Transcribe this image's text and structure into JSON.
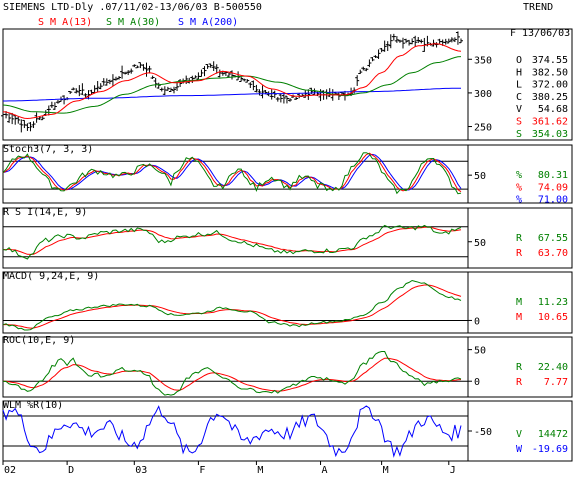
{
  "header": {
    "title": "SIEMENS LTD-Dly .07/11/02-13/06/03  B-500550",
    "trend_label": "TREND",
    "legend": [
      {
        "label": "S M A(13)",
        "color": "#ff0000"
      },
      {
        "label": "S M A(30)",
        "color": "#008000"
      },
      {
        "label": "S M A(200)",
        "color": "#0000ff"
      }
    ]
  },
  "x_axis_labels": [
    "02",
    "D",
    "03",
    "F",
    "M",
    "A",
    "M",
    "J"
  ],
  "colors": {
    "red": "#ff0000",
    "green": "#008000",
    "blue": "#0000ff",
    "black": "#000000",
    "frame": "#000000"
  },
  "chart_data": [
    {
      "type": "line",
      "name": "price",
      "title": "SIEMENS LTD-Dly .07/11/02-13/06/03  B-500550",
      "date_range": [
        "07/11/02",
        "13/06/03"
      ],
      "ylim": [
        230,
        395
      ],
      "y_ticks": [
        250,
        300,
        350
      ],
      "legend_placement": "top-left",
      "info": {
        "date": "F 13/06/03",
        "rows": [
          {
            "label": "O",
            "value": "374.55",
            "color": "#000000"
          },
          {
            "label": "H",
            "value": "382.50",
            "color": "#000000"
          },
          {
            "label": "L",
            "value": "372.00",
            "color": "#000000"
          },
          {
            "label": "C",
            "value": "380.25",
            "color": "#000000"
          },
          {
            "label": "V",
            "value": "54.68",
            "color": "#000000"
          },
          {
            "label": "S",
            "value": "361.62",
            "color": "#ff0000"
          },
          {
            "label": "S",
            "value": "354.03",
            "color": "#008000"
          }
        ]
      },
      "close_anchors": [
        [
          0,
          268
        ],
        [
          4,
          262
        ],
        [
          8,
          248
        ],
        [
          12,
          262
        ],
        [
          16,
          280
        ],
        [
          20,
          292
        ],
        [
          24,
          305
        ],
        [
          28,
          298
        ],
        [
          32,
          312
        ],
        [
          36,
          320
        ],
        [
          40,
          330
        ],
        [
          44,
          340
        ],
        [
          48,
          335
        ],
        [
          50,
          312
        ],
        [
          53,
          306
        ],
        [
          56,
          308
        ],
        [
          60,
          318
        ],
        [
          64,
          325
        ],
        [
          68,
          342
        ],
        [
          72,
          330
        ],
        [
          76,
          322
        ],
        [
          80,
          318
        ],
        [
          84,
          303
        ],
        [
          88,
          296
        ],
        [
          92,
          292
        ],
        [
          96,
          292
        ],
        [
          100,
          300
        ],
        [
          104,
          300
        ],
        [
          108,
          296
        ],
        [
          112,
          298
        ],
        [
          114,
          302
        ],
        [
          118,
          334
        ],
        [
          122,
          355
        ],
        [
          125,
          370
        ],
        [
          128,
          382
        ],
        [
          132,
          376
        ],
        [
          136,
          378
        ],
        [
          140,
          372
        ],
        [
          144,
          374
        ],
        [
          148,
          382
        ],
        [
          150,
          380
        ]
      ],
      "sma13_anchors": [
        [
          0,
          272
        ],
        [
          8,
          262
        ],
        [
          16,
          268
        ],
        [
          24,
          288
        ],
        [
          32,
          302
        ],
        [
          40,
          318
        ],
        [
          48,
          330
        ],
        [
          56,
          315
        ],
        [
          64,
          318
        ],
        [
          72,
          332
        ],
        [
          80,
          325
        ],
        [
          88,
          306
        ],
        [
          96,
          295
        ],
        [
          104,
          297
        ],
        [
          112,
          297
        ],
        [
          118,
          308
        ],
        [
          124,
          330
        ],
        [
          130,
          355
        ],
        [
          136,
          370
        ],
        [
          142,
          373
        ],
        [
          150,
          362
        ]
      ],
      "sma30_anchors": [
        [
          0,
          282
        ],
        [
          10,
          272
        ],
        [
          20,
          270
        ],
        [
          30,
          280
        ],
        [
          40,
          298
        ],
        [
          50,
          312
        ],
        [
          60,
          318
        ],
        [
          70,
          322
        ],
        [
          80,
          325
        ],
        [
          90,
          316
        ],
        [
          100,
          304
        ],
        [
          112,
          296
        ],
        [
          118,
          300
        ],
        [
          126,
          312
        ],
        [
          134,
          330
        ],
        [
          142,
          345
        ],
        [
          150,
          354
        ]
      ],
      "sma200_anchors": [
        [
          0,
          288
        ],
        [
          30,
          292
        ],
        [
          60,
          296
        ],
        [
          90,
          299
        ],
        [
          120,
          302
        ],
        [
          150,
          307
        ]
      ]
    },
    {
      "type": "line",
      "name": "Stoch3(7, 3, 3)",
      "ylim": [
        -10,
        115
      ],
      "y_ticks": [
        50
      ],
      "ref_lines": [
        20,
        80
      ],
      "info": {
        "rows": [
          {
            "label": "%",
            "value": "80.31",
            "color": "#008000"
          },
          {
            "label": "%",
            "value": "74.09",
            "color": "#ff0000"
          },
          {
            "label": "%",
            "value": "71.00",
            "color": "#0000ff"
          }
        ]
      }
    },
    {
      "type": "line",
      "name": "R S I(14,E, 9)",
      "ylim": [
        15,
        95
      ],
      "y_ticks": [
        50
      ],
      "ref_lines": [
        30,
        70
      ],
      "rsi_anchors": [
        [
          0,
          42
        ],
        [
          8,
          30
        ],
        [
          14,
          52
        ],
        [
          20,
          58
        ],
        [
          26,
          55
        ],
        [
          32,
          62
        ],
        [
          40,
          65
        ],
        [
          46,
          66
        ],
        [
          52,
          50
        ],
        [
          58,
          56
        ],
        [
          64,
          60
        ],
        [
          70,
          62
        ],
        [
          76,
          52
        ],
        [
          82,
          45
        ],
        [
          88,
          38
        ],
        [
          94,
          35
        ],
        [
          100,
          38
        ],
        [
          108,
          38
        ],
        [
          114,
          42
        ],
        [
          120,
          58
        ],
        [
          126,
          70
        ],
        [
          132,
          68
        ],
        [
          138,
          70
        ],
        [
          144,
          60
        ],
        [
          148,
          66
        ],
        [
          150,
          67.55
        ]
      ],
      "info": {
        "rows": [
          {
            "label": "R",
            "value": "67.55",
            "color": "#008000"
          },
          {
            "label": "R",
            "value": "63.70",
            "color": "#ff0000"
          }
        ]
      }
    },
    {
      "type": "line",
      "name": "MACD( 9,24,E, 9)",
      "ylim": [
        -7,
        27
      ],
      "y_ticks": [
        0
      ],
      "ref_lines": [
        0
      ],
      "macd_anchors": [
        [
          0,
          -2
        ],
        [
          8,
          -5
        ],
        [
          16,
          2
        ],
        [
          24,
          6
        ],
        [
          32,
          8
        ],
        [
          40,
          9
        ],
        [
          48,
          8
        ],
        [
          56,
          3
        ],
        [
          64,
          4
        ],
        [
          72,
          7
        ],
        [
          80,
          5
        ],
        [
          88,
          -1
        ],
        [
          96,
          -3
        ],
        [
          104,
          -1
        ],
        [
          112,
          0
        ],
        [
          118,
          3
        ],
        [
          124,
          10
        ],
        [
          130,
          18
        ],
        [
          134,
          22
        ],
        [
          138,
          21
        ],
        [
          144,
          14
        ],
        [
          150,
          11.23
        ]
      ],
      "info": {
        "rows": [
          {
            "label": "M",
            "value": "11.23",
            "color": "#008000"
          },
          {
            "label": "M",
            "value": "10.65",
            "color": "#ff0000"
          }
        ]
      }
    },
    {
      "type": "line",
      "name": "ROC(10,E, 9)",
      "ylim": [
        -25,
        70
      ],
      "y_ticks": [
        50,
        0
      ],
      "ref_lines": [
        0
      ],
      "info": {
        "rows": [
          {
            "label": "R",
            "value": "22.40",
            "color": "#008000"
          },
          {
            "label": "R",
            "value": "7.77",
            "color": "#ff0000"
          }
        ]
      }
    },
    {
      "type": "line",
      "name": "WLM %R(10)",
      "ylim": [
        -110,
        10
      ],
      "y_ticks": [
        -50
      ],
      "ref_lines": [
        -20,
        -80
      ],
      "info": {
        "rows": [
          {
            "label": "V",
            "value": "14472",
            "color": "#008000"
          },
          {
            "label": "W",
            "value": "-19.69",
            "color": "#0000ff"
          }
        ]
      }
    }
  ]
}
